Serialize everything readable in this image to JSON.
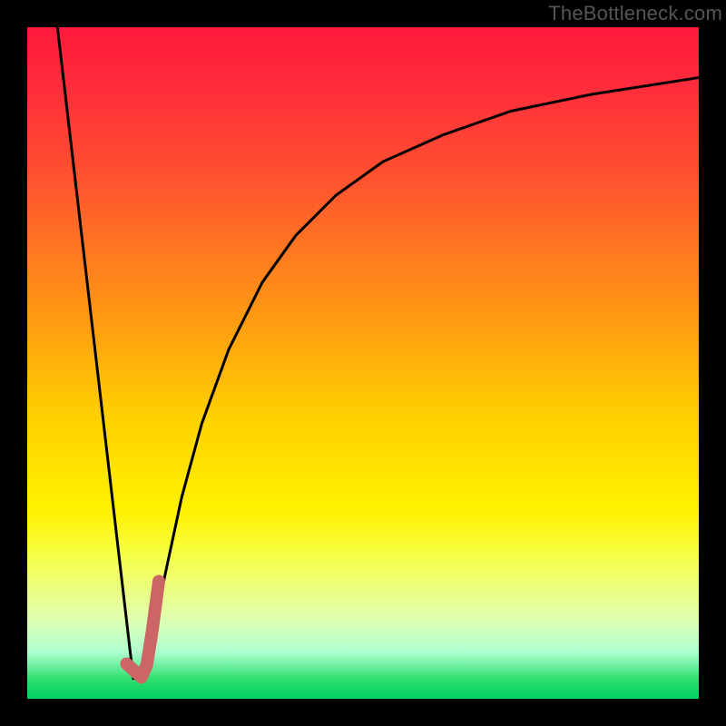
{
  "watermark": "TheBottleneck.com",
  "chart_data": {
    "type": "line",
    "title": "",
    "xlabel": "",
    "ylabel": "",
    "xlim": [
      0,
      100
    ],
    "ylim": [
      0,
      100
    ],
    "grid": false,
    "legend": null,
    "series": [
      {
        "name": "descending-segment",
        "stroke": "#000000",
        "x": [
          4.5,
          15.8
        ],
        "values": [
          100,
          3
        ]
      },
      {
        "name": "asymptotic-curve",
        "stroke": "#000000",
        "x": [
          17.5,
          20,
          23,
          26,
          30,
          35,
          40,
          46,
          53,
          62,
          72,
          84,
          100
        ],
        "values": [
          3,
          16,
          30,
          41,
          52,
          62,
          69,
          75,
          80,
          84,
          87.5,
          90,
          92.5
        ]
      },
      {
        "name": "highlight-mark",
        "stroke": "#cc6666",
        "x": [
          14.8,
          17.0,
          17.8,
          18.6,
          19.6
        ],
        "values": [
          5.2,
          3.2,
          5.0,
          10.0,
          17.5
        ]
      }
    ]
  },
  "colors": {
    "background": "#000000",
    "curve": "#000000",
    "highlight": "#cc6666",
    "gradient_top": "#ff1a3c",
    "gradient_mid": "#fff200",
    "gradient_bottom": "#00d060"
  }
}
